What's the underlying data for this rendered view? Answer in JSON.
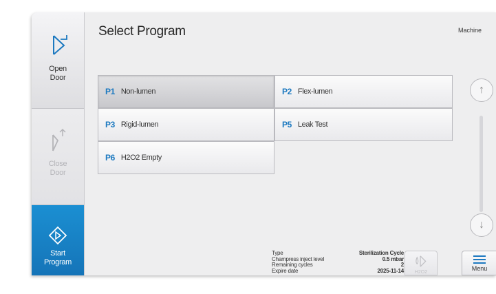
{
  "sidebar": {
    "open_door": "Open\nDoor",
    "close_door": "Close\nDoor",
    "start_program": "Start\nProgram"
  },
  "header": {
    "title": "Select Program",
    "machine": "Machine"
  },
  "programs": [
    {
      "code": "P1",
      "name": "Non-lumen",
      "selected": true
    },
    {
      "code": "P2",
      "name": "Flex-lumen",
      "selected": false
    },
    {
      "code": "P3",
      "name": "Rigid-lumen",
      "selected": false
    },
    {
      "code": "P5",
      "name": "Leak Test",
      "selected": false
    },
    {
      "code": "P6",
      "name": "H2O2 Empty",
      "selected": false
    }
  ],
  "scroll": {
    "up_icon": "arrow-up-icon",
    "down_icon": "arrow-down-icon"
  },
  "info": {
    "type_label": "Type",
    "type_value": "Sterilization Cycle",
    "inject_label": "Champress inject level",
    "inject_value": "0.5 mbar",
    "cycles_label": "Remaining cycles",
    "cycles_value": "2",
    "expire_label": "Expire date",
    "expire_value": "2025-11-14"
  },
  "buttons": {
    "h2o2": "H2O2",
    "menu": "Menu"
  },
  "colors": {
    "accent": "#1b8fd2",
    "program_code": "#1c79c0"
  }
}
